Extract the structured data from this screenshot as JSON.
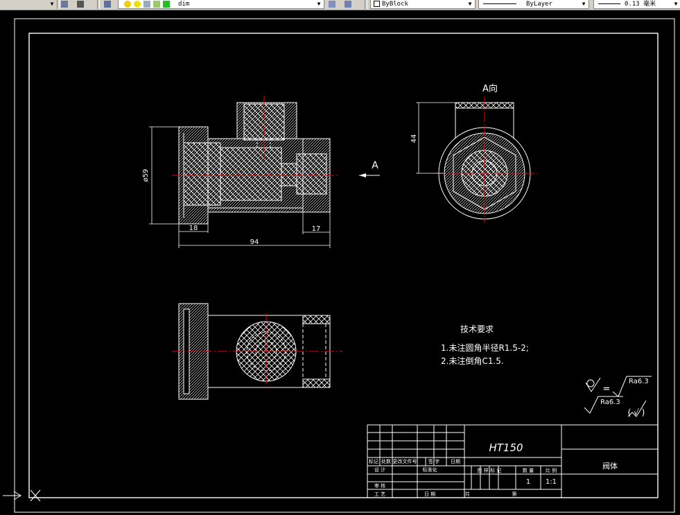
{
  "toolbar": {
    "layer_name": "dim",
    "color": "ByBlock",
    "linetype": "ByLayer",
    "lineweight": "0.13 毫米"
  },
  "drawing": {
    "dim_diameter": "ø59",
    "dim_18": "18",
    "dim_17": "17",
    "dim_94": "94",
    "dim_44": "44",
    "view_arrow_label": "A",
    "view_title": "A向"
  },
  "tech_requirements": {
    "title": "技术要求",
    "line1": "1.未注圆角半径R1.5-2;",
    "line2": "2.未注倒角C1.5."
  },
  "roughness": {
    "value": "Ra6.3",
    "equals": "=",
    "paren": "( √ )"
  },
  "title_block": {
    "material": "HT150",
    "part_name": "阀体",
    "labels_row1": [
      "标记",
      "处数",
      "更改文件号",
      "签 字",
      "日期"
    ],
    "design": "设 计",
    "standard": "标准化",
    "review": "审 核",
    "process": "工 艺",
    "date": "日 期",
    "stage_headers": [
      "图 样 标 记",
      "数 量",
      "比 例"
    ],
    "quantity": "1",
    "scale": "1:1",
    "sheet_total": "共",
    "sheet_no": "第"
  }
}
